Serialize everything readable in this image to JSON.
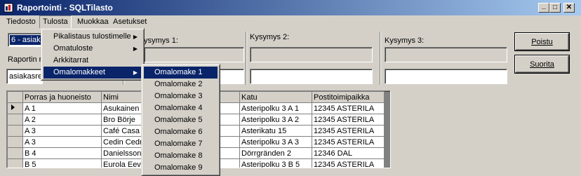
{
  "window": {
    "title": "Raportointi - SQLTilasto",
    "min": "_",
    "max": "□",
    "close": "✕"
  },
  "menubar": [
    "Tiedosto",
    "Tulosta",
    "Muokkaa",
    "Asetukset"
  ],
  "tulosta_menu": [
    {
      "label": "Pikalistaus tulostimelle",
      "submenu": true
    },
    {
      "label": "Omatuloste",
      "submenu": true
    },
    {
      "label": "Arkkitarrat",
      "submenu": false
    },
    {
      "label": "Omalomakkeet",
      "submenu": true
    }
  ],
  "omalomakkeet_submenu": [
    "Omalomake 1",
    "Omalomake 2",
    "Omalomake 3",
    "Omalomake 4",
    "Omalomake 5",
    "Omalomake 6",
    "Omalomake 7",
    "Omalomake 8",
    "Omalomake 9"
  ],
  "form": {
    "report_select_value": "6 - asiak",
    "report_label": "Raportin n",
    "report_name_value": "asiakasre",
    "q1_label": "ysymys 1:",
    "q2_label": "Kysymys 2:",
    "q3_label": "Kysymys 3:"
  },
  "buttons": {
    "exit": "Poistu",
    "run": "Suorita"
  },
  "grid": {
    "columns": [
      "Porras ja huoneisto",
      "Nimi",
      "",
      "Katu",
      "Postitoimipaikka"
    ],
    "rows": [
      [
        "A 1",
        "Asukainen",
        "",
        "Asteripolku 3 A 1",
        "12345 ASTERILA"
      ],
      [
        "A 2",
        "Bro Börje",
        "",
        "Asteripolku 3 A 2",
        "12345 ASTERILA"
      ],
      [
        "A 3",
        "Café Casa",
        "",
        "Asterikatu 15",
        "12345 ASTERILA"
      ],
      [
        "A 3",
        "Cedin Cedr",
        "",
        "Asteripolku 3 A 3",
        "12345 ASTERILA"
      ],
      [
        "B 4",
        "Danielsson",
        "",
        "Dörrgränden 2",
        "12346 DAL"
      ],
      [
        "B 5",
        "Eurola Eev",
        "",
        "Asteripolku 3 B 5",
        "12345 ASTERILA"
      ]
    ]
  },
  "icons": {
    "window": "app-window-icon",
    "row_pointer": "row-pointer-icon",
    "submenu": "submenu-arrow-icon"
  }
}
